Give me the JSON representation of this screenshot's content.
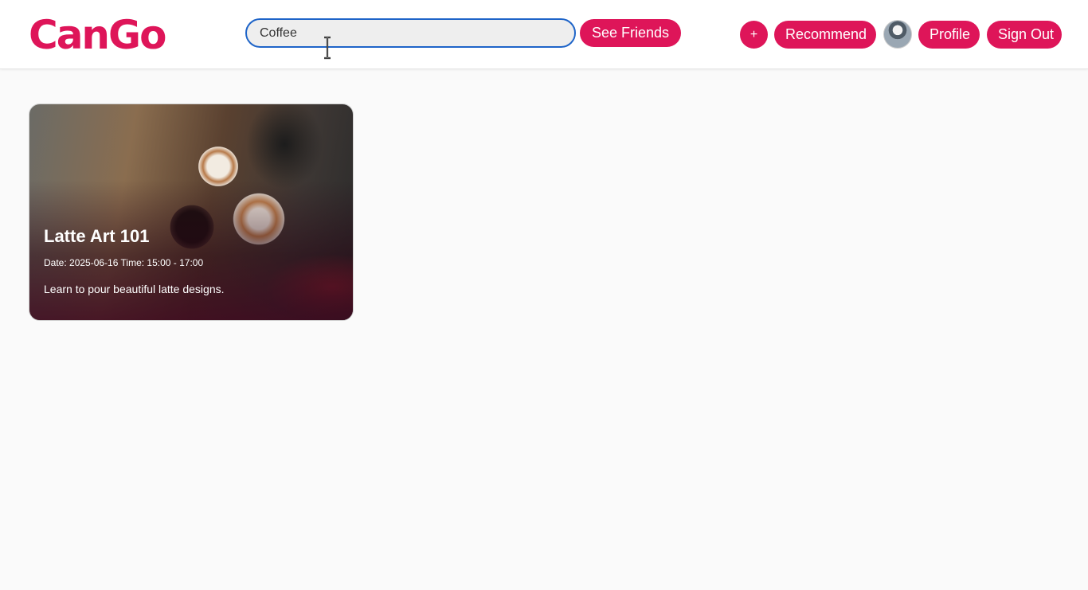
{
  "brand": {
    "name": "CanGo",
    "color": "#de1559"
  },
  "search": {
    "value": "Coffee",
    "placeholder": ""
  },
  "nav": {
    "see_friends": "See Friends",
    "add": "+",
    "recommend": "Recommend",
    "profile": "Profile",
    "sign_out": "Sign Out",
    "avatar_icon": "user-avatar"
  },
  "events": [
    {
      "title": "Latte Art 101",
      "meta": "Date: 2025-06-16 Time: 15:00 - 17:00",
      "description": "Learn to pour beautiful latte designs.",
      "image_icon": "coffee-cups-photo"
    }
  ]
}
